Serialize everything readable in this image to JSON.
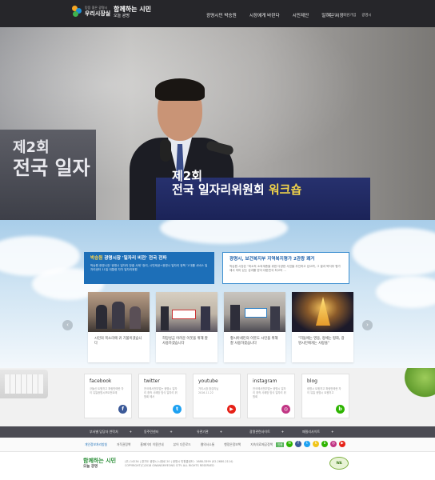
{
  "header": {
    "logo1_small": "믿음 좋은 광명시",
    "logo1_main": "우리시장실",
    "logo2_main": "함께하는 시민",
    "logo2_sub": "오늘 광명",
    "nav": [
      "광명시민 박승원",
      "시장에게 바란다",
      "시민제안",
      "일하는 시장"
    ],
    "util": [
      "로그인",
      "회원가입",
      "광명시"
    ]
  },
  "hero": {
    "bg_line1": "제2회",
    "bg_line2": "전국 일자",
    "podium_line1": "제2회",
    "podium_line2": "전국 일자리위원회",
    "podium_highlight": "워크숍"
  },
  "news": {
    "a_title_name": "박승원",
    "a_title_rest": " 광명시장 '일자리 비전' 전국 전파",
    "a_body": "박승원 광명시장 '광명시 일자리 창출 사례' 정리, 시민제공+광명시 일자리 정책 '1'대를 서비스 일자리센터 11일 대통령 자차 일자리위원",
    "b_title": "광명시, 보건복지부 지역복지평가 2관왕 쾌거",
    "b_body": "박승원 시장은 \"최소득 소외계층을 위한 다양한 사업을 추진하고 있으며, 그 결과 복지부 평가에서 의미 있는 성과를 받아 대한민국 최고의 ..."
  },
  "cards": [
    {
      "caption": "시민의 목소리에 귀 기울이겠습니다"
    },
    {
      "caption": "희망성금 어려운 이웃을 위해 잘 사용하겠습니다"
    },
    {
      "caption": "황시아세민의 이웃도 시민을 위해 잘 사용하겠습니다"
    },
    {
      "caption": "\"허들에는 영웅, 정체는 평화, 광명시민에게는 사랑을\""
    }
  ],
  "sns": [
    {
      "name": "facebook",
      "desc": "규들신 트윗허고 퍼링만에란 자이 유일광명시포트먼트에",
      "icon": "f",
      "color": "#3b5998"
    },
    {
      "name": "twitter",
      "desc": "전국에서전부업는 광명시 일자리 창작 사례방 방식 일자리 위원회 에서",
      "icon": "t",
      "color": "#1da1f2"
    },
    {
      "name": "youtube",
      "desc": "거리시장 참감리님2016.11.22",
      "icon": "▶",
      "color": "#e62117"
    },
    {
      "name": "instagram",
      "desc": "전국에서전부업는 광명시 일자리 창작 사례방 방식 일자리 위원회",
      "icon": "◎",
      "color": "#c13584"
    },
    {
      "name": "blog",
      "desc": "광명시 트윗허고 퍼링만에란 자이 유일 광명시 트윗허고",
      "icon": "b",
      "color": "#2db400"
    }
  ],
  "related": [
    "부서별 담당자 연락처",
    "동주민센터",
    "유관기관",
    "광명관련사이트",
    "패밀리사이트"
  ],
  "footer": {
    "links": [
      "개인정보처리방침",
      "저작권정책",
      "홈페이지 이용안내",
      "뷰어 다운로드",
      "웹의사소통",
      "행정은정보책",
      "지속의료제공정책"
    ],
    "badge": "인증",
    "circles": [
      {
        "icon": "N",
        "color": "#2db400"
      },
      {
        "icon": "f",
        "color": "#3b5998"
      },
      {
        "icon": "t",
        "color": "#1da1f2"
      },
      {
        "icon": "k",
        "color": "#f0c419"
      },
      {
        "icon": "b",
        "color": "#2db400"
      },
      {
        "icon": "◎",
        "color": "#c13584"
      },
      {
        "icon": "▶",
        "color": "#e62117"
      }
    ],
    "logo_main": "함께하는 시민",
    "logo_sub": "오늘 광명",
    "addr": "(우) 14234 | 경기도 광명시 시청로 20 | 광명시 민원콜센터 : 1688-3399 (02-2680-2114)",
    "copyright": "COPYRIGHT(C)2018 GWANGMYEONG CITY. ALL RIGHTS RESERVED",
    "cert": "WA"
  }
}
